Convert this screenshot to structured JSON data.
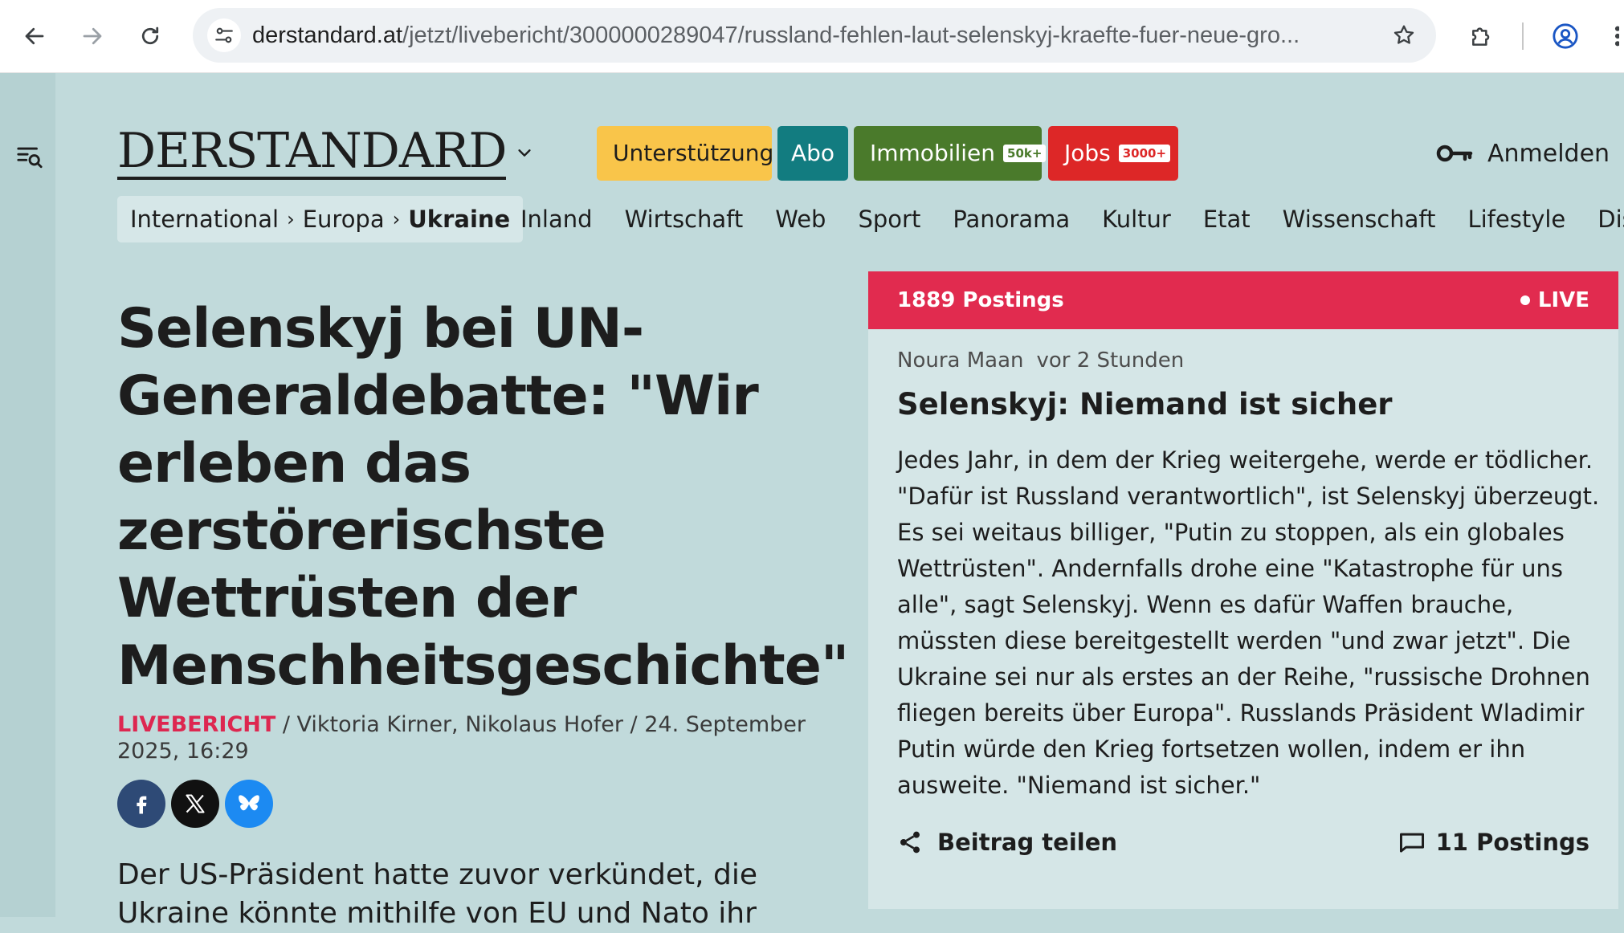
{
  "browser": {
    "url_host": "derstandard.at",
    "url_path": "/jetzt/livebericht/3000000289047/russland-fehlen-laut-selenskyj-kraefte-fuer-neue-gro..."
  },
  "header": {
    "logo": "DERSTANDARD",
    "pills": {
      "support": "Unterstützung",
      "abo": "Abo",
      "immobilien": "Immobilien",
      "immobilien_badge": "50k+",
      "jobs": "Jobs",
      "jobs_badge": "3000+"
    },
    "login": "Anmelden"
  },
  "breadcrumb": {
    "items": [
      "International",
      "Europa",
      "Ukraine"
    ]
  },
  "nav": {
    "items": [
      "Inland",
      "Wirtschaft",
      "Web",
      "Sport",
      "Panorama",
      "Kultur",
      "Etat",
      "Wissenschaft",
      "Lifestyle",
      "Diskurs"
    ]
  },
  "article": {
    "headline": "Selenskyj bei UN-Generaldebatte: \"Wir erleben das zerstörerischste Wettrüsten der Menschheitsgeschichte\"",
    "kicker": "LIVEBERICHT",
    "byline_rest": " / Viktoria Kirner, Nikolaus Hofer / 24. September 2025, 16:29",
    "lead": "Der US-Präsident hatte zuvor verkündet, die Ukraine könnte mithilfe von EU und Nato ihr"
  },
  "live": {
    "postings_count": "1889 Postings",
    "live_label": "LIVE",
    "post": {
      "author": "Noura Maan",
      "time": "vor 2 Stunden",
      "title": "Selenskyj: Niemand ist sicher",
      "body": "Jedes Jahr, in dem der Krieg weitergehe, werde er tödlicher. \"Dafür ist Russland verantwortlich\", ist Selenskyj überzeugt. Es sei weitaus billiger, \"Putin zu stoppen, als ein globales Wettrüsten\". Andernfalls drohe eine \"Katastrophe für uns alle\", sagt Selenskyj. Wenn es dafür Waffen brauche, müssten diese bereitgestellt werden \"und zwar jetzt\". Die Ukraine sei nur als erstes an der Reihe, \"russische Drohnen fliegen bereits über Europa\". Russlands Präsident Wladimir Putin würde den Krieg fortsetzen wollen, indem er ihn ausweite. \"Niemand ist sicher.\"",
      "share_label": "Beitrag teilen",
      "postings_label": "11 Postings"
    }
  },
  "colors": {
    "page_bg": "#c1dadb",
    "live_red": "#e12b4f",
    "support_yellow": "#f9c54a",
    "abo_teal": "#127c80",
    "immo_green": "#4a7a2b",
    "jobs_red": "#dd2727"
  },
  "icons": {
    "back": "arrow-left-icon",
    "forward": "arrow-right-icon",
    "reload": "reload-icon",
    "site_info": "tune-icon",
    "bookmark": "star-icon",
    "extensions": "puzzle-icon",
    "profile": "profile-icon",
    "more": "more-icon",
    "filter": "filter-search-icon",
    "login": "key-icon",
    "share": "share-icon",
    "postings": "comment-icon"
  }
}
